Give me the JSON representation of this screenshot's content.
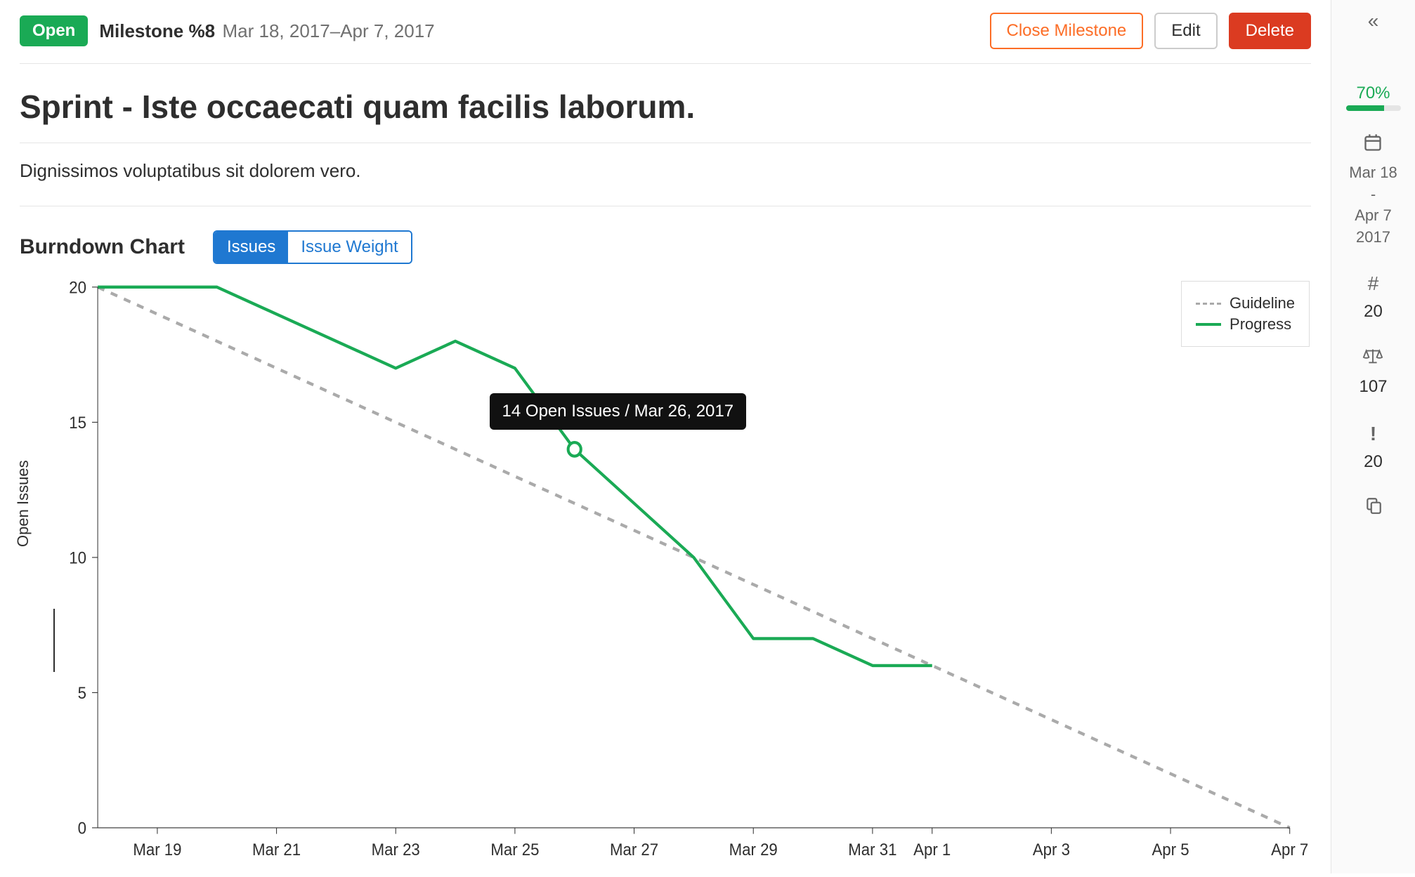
{
  "header": {
    "status_label": "Open",
    "milestone_label": "Milestone %8",
    "date_range": "Mar 18, 2017–Apr 7, 2017",
    "close_label": "Close Milestone",
    "edit_label": "Edit",
    "delete_label": "Delete"
  },
  "title": "Sprint - Iste occaecati quam facilis laborum.",
  "description": "Dignissimos voluptatibus sit dolorem vero.",
  "chart": {
    "title": "Burndown Chart",
    "tab_issues": "Issues",
    "tab_weight": "Issue Weight",
    "ylabel": "Open Issues",
    "legend_guideline": "Guideline",
    "legend_progress": "Progress",
    "tooltip": "14 Open Issues / Mar 26, 2017"
  },
  "sidebar": {
    "percent_label": "70%",
    "percent": 70,
    "date_line1": "Mar 18",
    "date_dash": "-",
    "date_line2": "Apr 7",
    "date_line3": "2017",
    "hash_value": "20",
    "weight_value": "107",
    "issues_value": "20"
  },
  "chart_data": {
    "type": "line",
    "title": "Burndown Chart",
    "xlabel": "",
    "ylabel": "Open Issues",
    "ylim": [
      0,
      20
    ],
    "x_ticks": [
      "Mar 19",
      "Mar 21",
      "Mar 23",
      "Mar 25",
      "Mar 27",
      "Mar 29",
      "Mar 31",
      "Apr 1",
      "Apr 3",
      "Apr 5",
      "Apr 7"
    ],
    "y_ticks": [
      0,
      5,
      10,
      15,
      20
    ],
    "x": [
      "Mar 18",
      "Mar 19",
      "Mar 20",
      "Mar 21",
      "Mar 22",
      "Mar 23",
      "Mar 24",
      "Mar 25",
      "Mar 26",
      "Mar 27",
      "Mar 28",
      "Mar 29",
      "Mar 30",
      "Mar 31",
      "Apr 1",
      "Apr 2",
      "Apr 3",
      "Apr 4",
      "Apr 5",
      "Apr 6",
      "Apr 7"
    ],
    "series": [
      {
        "name": "Guideline",
        "style": "dashed",
        "color": "#aaaaaa",
        "values": [
          20,
          19,
          18,
          17,
          16,
          15,
          14,
          13,
          12,
          11,
          10,
          9,
          8,
          7,
          6,
          5,
          4,
          3,
          2,
          1,
          0
        ]
      },
      {
        "name": "Progress",
        "style": "solid",
        "color": "#1aaa55",
        "values": [
          20,
          20,
          20,
          19,
          18,
          17,
          18,
          17,
          14,
          12,
          10,
          7,
          7,
          6,
          6,
          null,
          null,
          null,
          null,
          null,
          null
        ]
      }
    ],
    "highlight": {
      "x": "Mar 26",
      "value": 14,
      "label": "14 Open Issues / Mar 26, 2017"
    }
  }
}
